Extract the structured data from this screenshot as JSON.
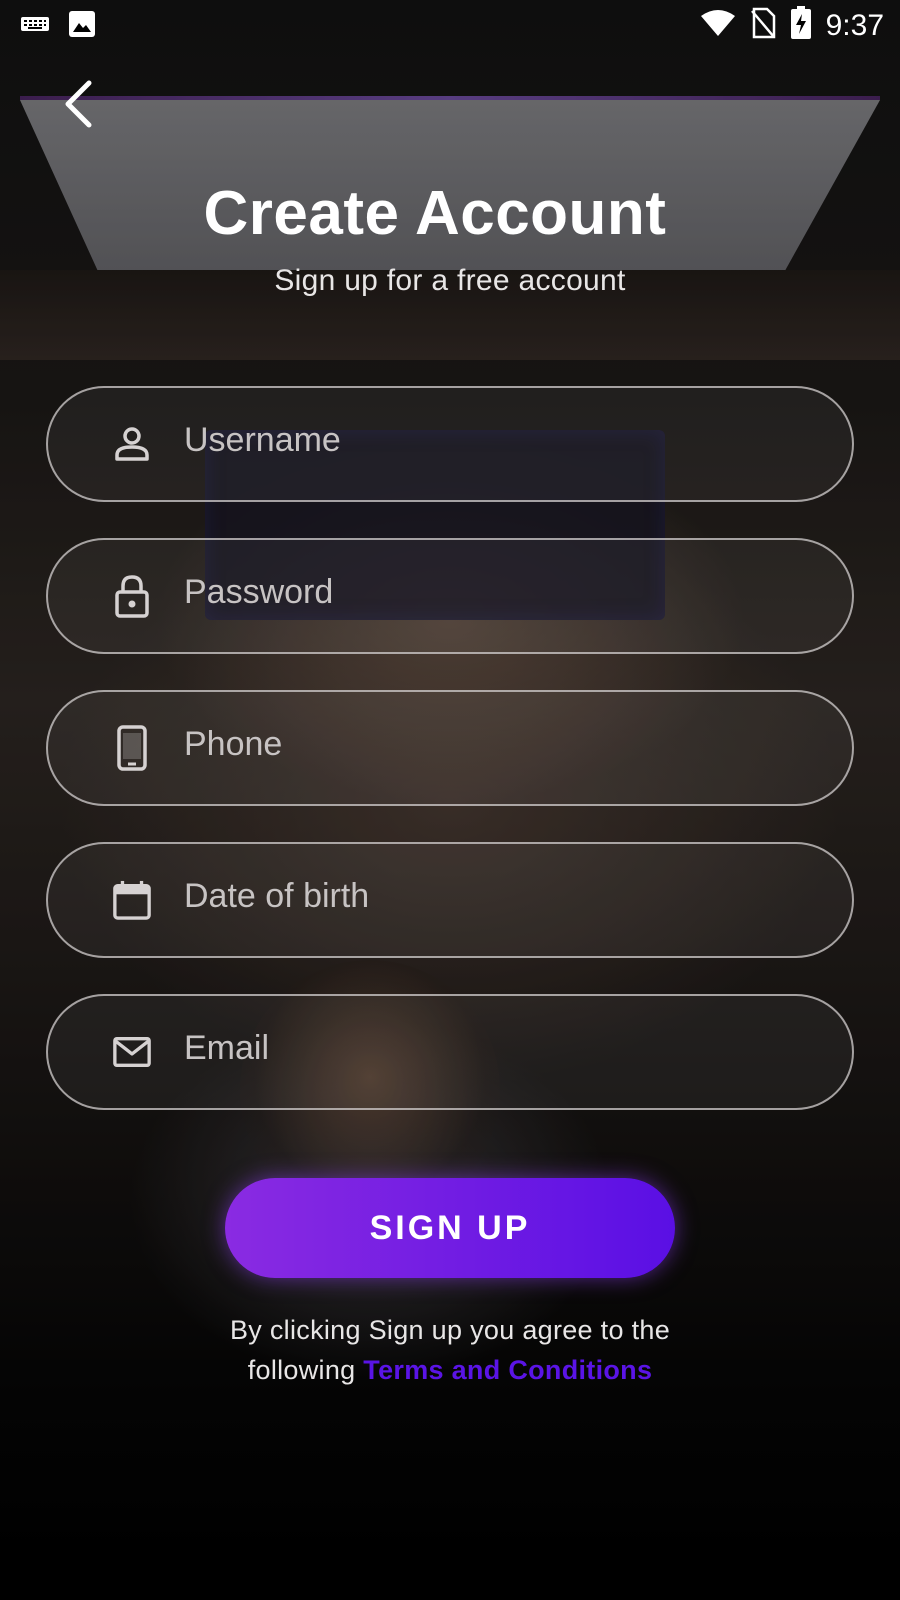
{
  "status_bar": {
    "time": "9:37",
    "icons_left": [
      "keyboard-icon",
      "image-icon"
    ],
    "icons_right": [
      "wifi-icon",
      "no-sim-icon",
      "battery-charging-icon"
    ]
  },
  "header": {
    "back_icon": "chevron-left-icon",
    "title": "Create Account",
    "subtitle": "Sign up for a free account"
  },
  "form": {
    "fields": [
      {
        "icon": "person-icon",
        "placeholder": "Username",
        "value": ""
      },
      {
        "icon": "lock-icon",
        "placeholder": "Password",
        "value": ""
      },
      {
        "icon": "phone-icon",
        "placeholder": "Phone",
        "value": ""
      },
      {
        "icon": "calendar-icon",
        "placeholder": "Date of birth",
        "value": ""
      },
      {
        "icon": "mail-icon",
        "placeholder": "Email",
        "value": ""
      }
    ],
    "submit_label": "SIGN UP"
  },
  "terms": {
    "line1": "By clicking Sign up you agree to the",
    "line2_prefix": "following",
    "link_text": "Terms and Conditions"
  },
  "colors": {
    "accent_start": "#8a2be2",
    "accent_end": "#5a0fe4",
    "link": "#5a14e6"
  }
}
